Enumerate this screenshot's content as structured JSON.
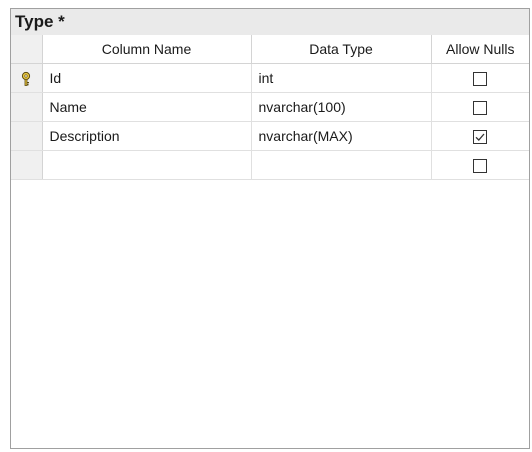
{
  "designer": {
    "title": "Type *",
    "headers": {
      "column_name": "Column Name",
      "data_type": "Data Type",
      "allow_nulls": "Allow Nulls"
    },
    "rows": [
      {
        "column_name": "Id",
        "data_type": "int",
        "allow_nulls": false,
        "primary_key": true
      },
      {
        "column_name": "Name",
        "data_type": "nvarchar(100)",
        "allow_nulls": false,
        "primary_key": false
      },
      {
        "column_name": "Description",
        "data_type": "nvarchar(MAX)",
        "allow_nulls": true,
        "primary_key": false
      },
      {
        "column_name": "",
        "data_type": "",
        "allow_nulls": false,
        "primary_key": false
      }
    ],
    "icons": {
      "primary_key": "key-icon",
      "checkbox": "checkbox-icon"
    },
    "colors": {
      "title_bar": "#eaeaea",
      "key_fill": "#e8c640",
      "grid_line": "#e0e0e0",
      "row_selector": "#f0f0f0"
    }
  }
}
